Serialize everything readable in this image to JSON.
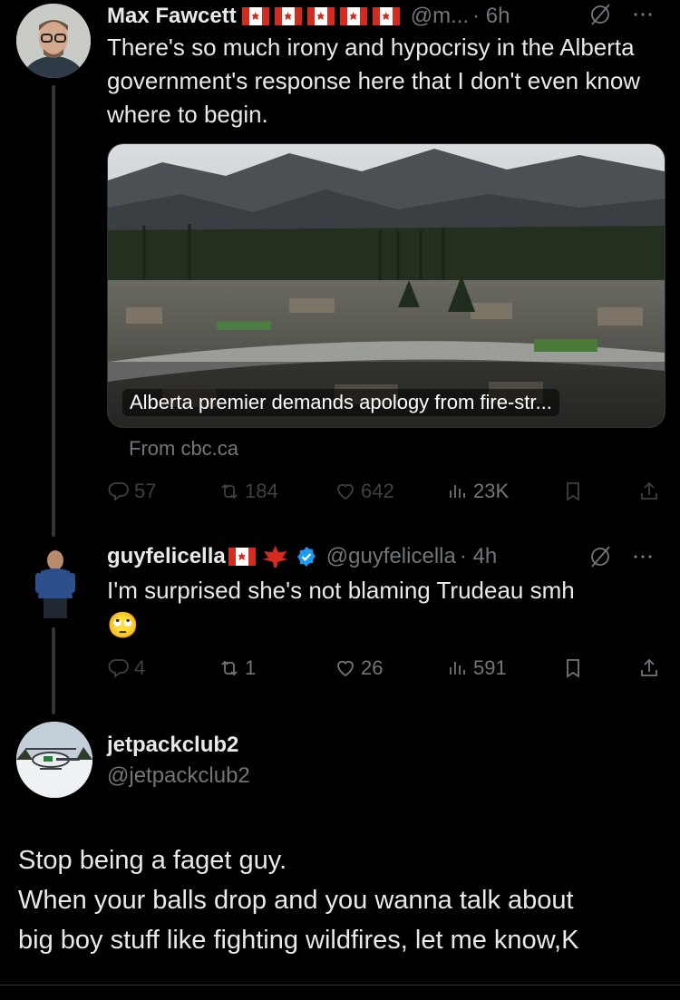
{
  "tweet1": {
    "name": "Max Fawcett",
    "handle": "@m...",
    "time": "· 6h",
    "text": "There's so much irony and hypocrisy in the Alberta government's response here that I don't even know where to begin.",
    "card_title": "Alberta premier demands apology from fire-str...",
    "card_source": "From cbc.ca",
    "replies": "57",
    "reposts": "184",
    "likes": "642",
    "views": "23K"
  },
  "tweet2": {
    "name": "guyfelicella",
    "handle": "@guyfelicella",
    "time": "· 4h",
    "text": "I'm surprised she's not blaming Trudeau smh",
    "emoji": "🙄",
    "replies": "4",
    "reposts": "1",
    "likes": "26",
    "views": "591"
  },
  "tweet3": {
    "name": "jetpackclub2",
    "handle": "@jetpackclub2",
    "text_lines": [
      "Stop being a faget guy.",
      "When your balls drop and you wanna talk about",
      "big boy stuff like fighting wildfires, let me know,K"
    ]
  },
  "icons": {
    "more": "more-icon",
    "grok": "grok-icon",
    "reply": "reply-icon",
    "repost": "repost-icon",
    "like": "like-icon",
    "views": "views-icon",
    "bookmark": "bookmark-icon",
    "share": "share-icon",
    "verified": "verified-badge-icon"
  },
  "colors": {
    "background": "#000000",
    "text": "#e7e9ea",
    "muted": "#71767b",
    "verified": "#1d9bf0",
    "flag_red": "#d52b1e"
  }
}
